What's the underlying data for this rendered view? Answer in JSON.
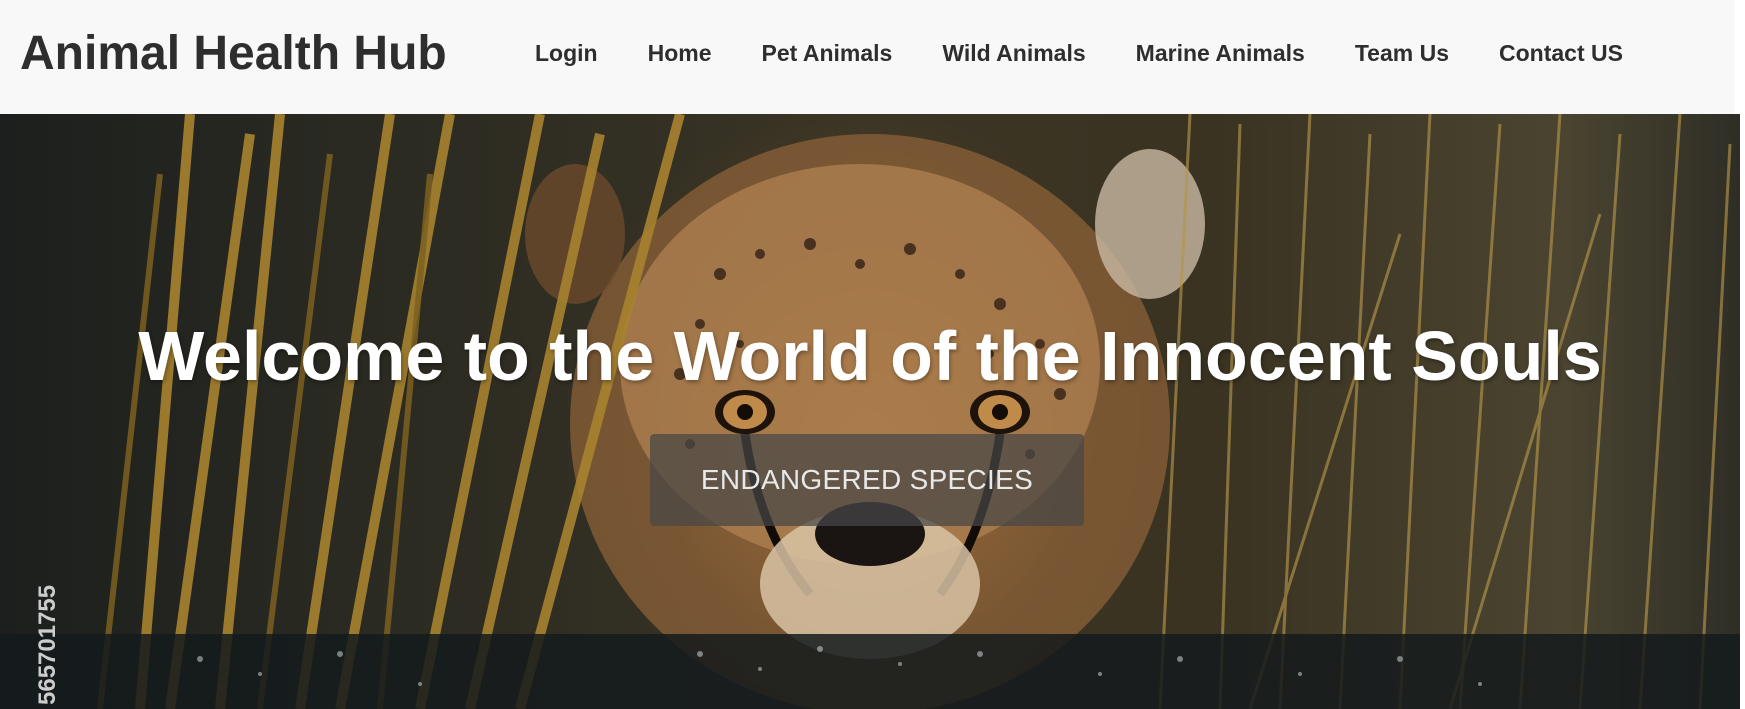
{
  "header": {
    "brand": "Animal Health Hub",
    "nav": [
      {
        "label": "Login"
      },
      {
        "label": "Home"
      },
      {
        "label": "Pet Animals"
      },
      {
        "label": "Wild Animals"
      },
      {
        "label": "Marine Animals"
      },
      {
        "label": "Team Us"
      },
      {
        "label": "Contact US"
      }
    ]
  },
  "hero": {
    "title": "Welcome to the World of the Innocent Souls",
    "button_label": "ENDANGERED SPECIES",
    "image_id": "565701755",
    "image_subject": "cheetah-face-in-grass-and-water"
  },
  "colors": {
    "navbar_bg": "#f8f8f8",
    "nav_text": "#2e2e2e",
    "hero_text": "#ffffff",
    "button_bg": "rgba(70,70,70,0.72)"
  }
}
